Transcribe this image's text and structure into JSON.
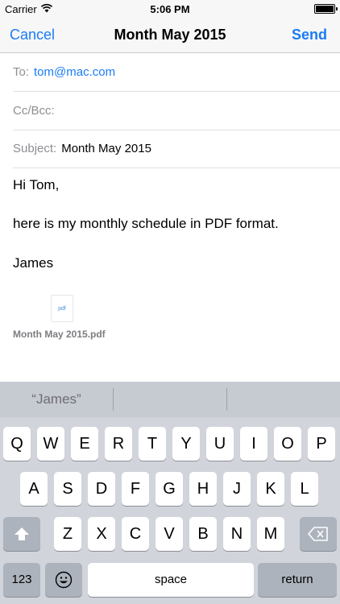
{
  "status_bar": {
    "carrier": "Carrier",
    "time": "5:06 PM",
    "wifi_icon": "wifi-icon",
    "battery_icon": "battery-icon"
  },
  "nav": {
    "cancel": "Cancel",
    "title": "Month May 2015",
    "send": "Send"
  },
  "compose": {
    "to_label": "To:",
    "to_value": "tom@mac.com",
    "ccbcc_label": "Cc/Bcc:",
    "subject_label": "Subject:",
    "subject_value": "Month May 2015",
    "body_lines": [
      "Hi Tom,",
      "here is my monthly schedule in PDF format.",
      "James"
    ],
    "attachment": {
      "icon_text": "pdf",
      "name": "Month May 2015.pdf"
    }
  },
  "keyboard": {
    "suggestions": [
      "“James”",
      "",
      ""
    ],
    "row1": [
      "Q",
      "W",
      "E",
      "R",
      "T",
      "Y",
      "U",
      "I",
      "O",
      "P"
    ],
    "row2": [
      "A",
      "S",
      "D",
      "F",
      "G",
      "H",
      "J",
      "K",
      "L"
    ],
    "row3": [
      "Z",
      "X",
      "C",
      "V",
      "B",
      "N",
      "M"
    ],
    "numbers_key": "123",
    "space_key": "space",
    "return_key": "return",
    "shift_icon": "shift-icon",
    "delete_icon": "delete-icon",
    "emoji_icon": "emoji-icon"
  }
}
